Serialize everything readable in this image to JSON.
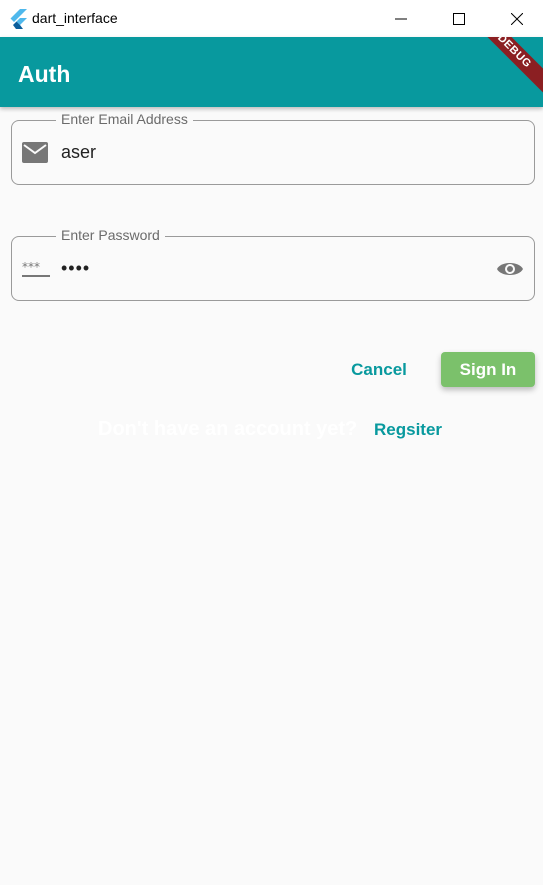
{
  "window": {
    "title": "dart_interface",
    "icon": "flutter-icon",
    "controls": [
      "minimize-icon",
      "maximize-icon",
      "close-icon"
    ]
  },
  "appbar": {
    "title": "Auth",
    "debug_banner": "DEBUG",
    "color": "#08999e"
  },
  "email": {
    "label": "Enter Email Address",
    "value": "aser",
    "icon": "email-icon"
  },
  "password": {
    "label": "Enter Password",
    "value": "••••",
    "icon": "password-icon",
    "toggle_icon": "visibility-icon"
  },
  "actions": {
    "cancel_label": "Cancel",
    "signin_label": "Sign In",
    "signin_color": "#7bc16b"
  },
  "register": {
    "prompt": "Don't have an account yet?",
    "link_label": "Regsiter"
  }
}
